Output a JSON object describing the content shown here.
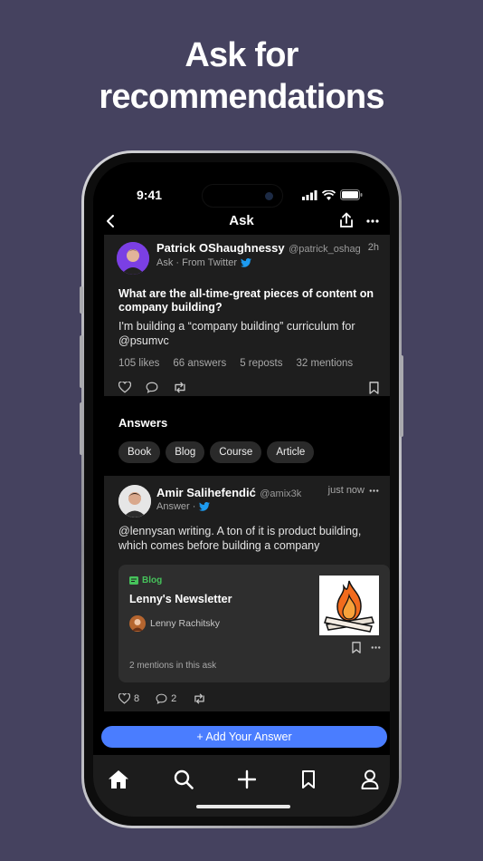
{
  "headline": {
    "line1": "Ask for",
    "line2": "recommendations"
  },
  "status_bar": {
    "time": "9:41"
  },
  "nav": {
    "title": "Ask"
  },
  "post": {
    "author_name": "Patrick OShaughnessy",
    "author_handle": "@patrick_oshag",
    "time_ago": "2h",
    "meta": "Ask · From Twitter",
    "title": "What are the all-time-great pieces of content on company building?",
    "body": "I'm building a “company building” curriculum for @psumvc",
    "stats": {
      "likes": "105 likes",
      "answers": "66 answers",
      "reposts": "5 reposts",
      "mentions": "32 mentions"
    }
  },
  "answers_section": {
    "heading": "Answers",
    "chips": [
      "Book",
      "Blog",
      "Course",
      "Article"
    ]
  },
  "answer": {
    "author_name": "Amir Salihefendić",
    "author_handle": "@amix3k",
    "time_ago": "just now",
    "meta": "Answer ·",
    "body": "@lennysan writing. A ton of it is product building, which comes before building a company",
    "card": {
      "tag": "Blog",
      "title": "Lenny's Newsletter",
      "author": "Lenny Rachitsky",
      "mentions": "2 mentions in this ask"
    },
    "likes": "8",
    "comments": "2"
  },
  "add_answer_label": "+ Add Your Answer",
  "colors": {
    "background": "#45425f",
    "accent": "#4a7dff",
    "twitter": "#1d9bf0",
    "tag_green": "#46c25b"
  },
  "tabbar": {
    "items": [
      "home-icon",
      "search-icon",
      "plus-icon",
      "bookmark-icon",
      "profile-icon"
    ]
  }
}
